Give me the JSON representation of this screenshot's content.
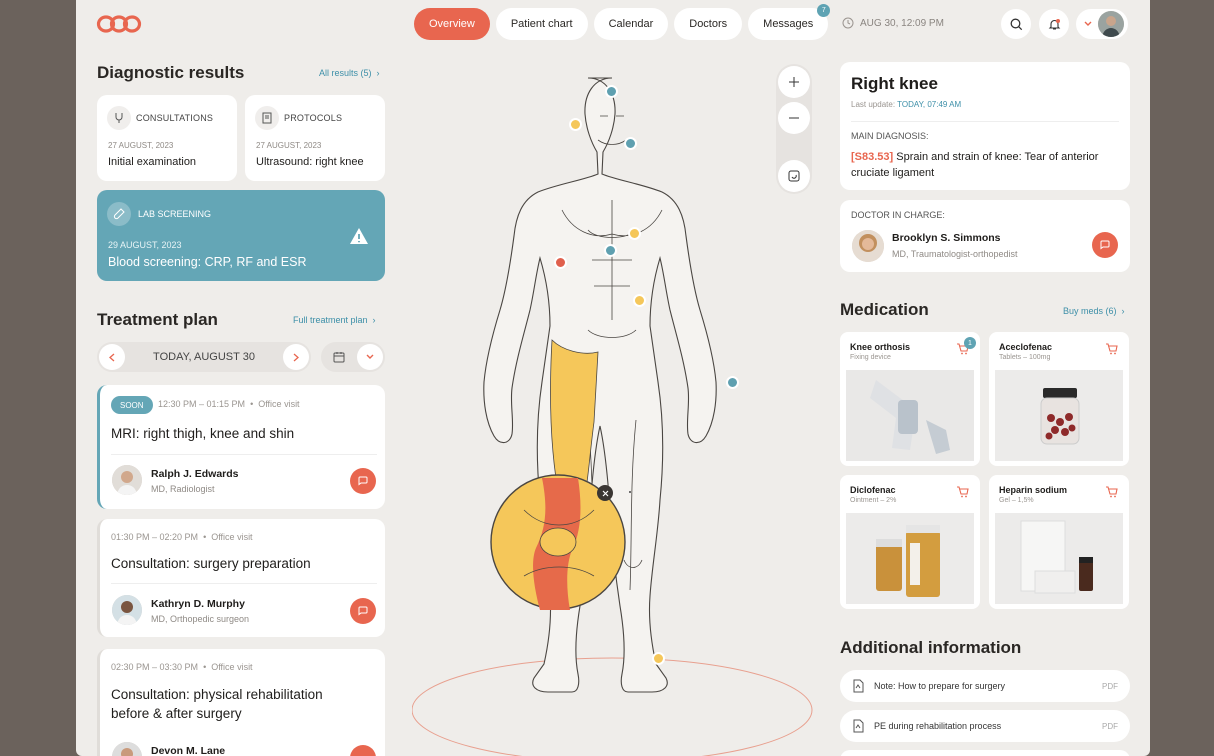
{
  "nav": {
    "tabs": [
      {
        "label": "Overview"
      },
      {
        "label": "Patient chart"
      },
      {
        "label": "Calendar"
      },
      {
        "label": "Doctors"
      },
      {
        "label": "Messages",
        "badge": "7"
      }
    ],
    "datetime": "AUG 30, 12:09 PM"
  },
  "diagnostic": {
    "title": "Diagnostic results",
    "all_link": "All results (5)",
    "cards": [
      {
        "category": "CONSULTATIONS",
        "date": "27 AUGUST, 2023",
        "name": "Initial examination"
      },
      {
        "category": "PROTOCOLS",
        "date": "27 AUGUST, 2023",
        "name": "Ultrasound: right knee"
      }
    ],
    "lab": {
      "category": "LAB SCREENING",
      "date": "29 AUGUST, 2023",
      "name": "Blood screening: CRP, RF and ESR"
    }
  },
  "treatment": {
    "title": "Treatment plan",
    "full_link": "Full treatment plan",
    "date_label": "TODAY, AUGUST 30",
    "items": [
      {
        "badge": "SOON",
        "time": "12:30 PM – 01:15 PM",
        "type": "Office visit",
        "title": "MRI: right thigh, knee and shin",
        "doctor": "Ralph J. Edwards",
        "role": "MD, Radiologist"
      },
      {
        "time": "01:30 PM – 02:20 PM",
        "type": "Office visit",
        "title": "Consultation: surgery preparation",
        "doctor": "Kathryn D. Murphy",
        "role": "MD, Orthopedic surgeon"
      },
      {
        "time": "02:30 PM – 03:30 PM",
        "type": "Office visit",
        "title": "Consultation: physical rehabilitation before & after surgery",
        "doctor": "Devon M. Lane"
      }
    ]
  },
  "knee": {
    "title": "Right knee",
    "update_label": "Last update:",
    "update_value": "TODAY, 07:49 AM",
    "diag_label": "MAIN DIAGNOSIS:",
    "code": "[S83.53]",
    "diagnosis": "Sprain and strain of knee: Tear of anterior cruciate ligament",
    "doctor_label": "DOCTOR IN CHARGE:",
    "doctor": "Brooklyn S. Simmons",
    "doctor_role": "MD, Traumatologist-orthopedist"
  },
  "medication": {
    "title": "Medication",
    "buy_link": "Buy meds (6)",
    "items": [
      {
        "name": "Knee orthosis",
        "sub": "Fixing device",
        "cart_badge": "1"
      },
      {
        "name": "Aceclofenac",
        "sub": "Tablets – 100mg"
      },
      {
        "name": "Diclofenac",
        "sub": "Ointment – 2%"
      },
      {
        "name": "Heparin sodium",
        "sub": "Gel – 1,5%"
      }
    ]
  },
  "additional": {
    "title": "Additional information",
    "docs": [
      {
        "name": "Note: How to prepare for surgery",
        "ext": "PDF"
      },
      {
        "name": "PE during rehabilitation process",
        "ext": "PDF"
      }
    ]
  },
  "colors": {
    "accent": "#e8664f",
    "teal": "#64a6b6",
    "yellow": "#f5c75a"
  }
}
